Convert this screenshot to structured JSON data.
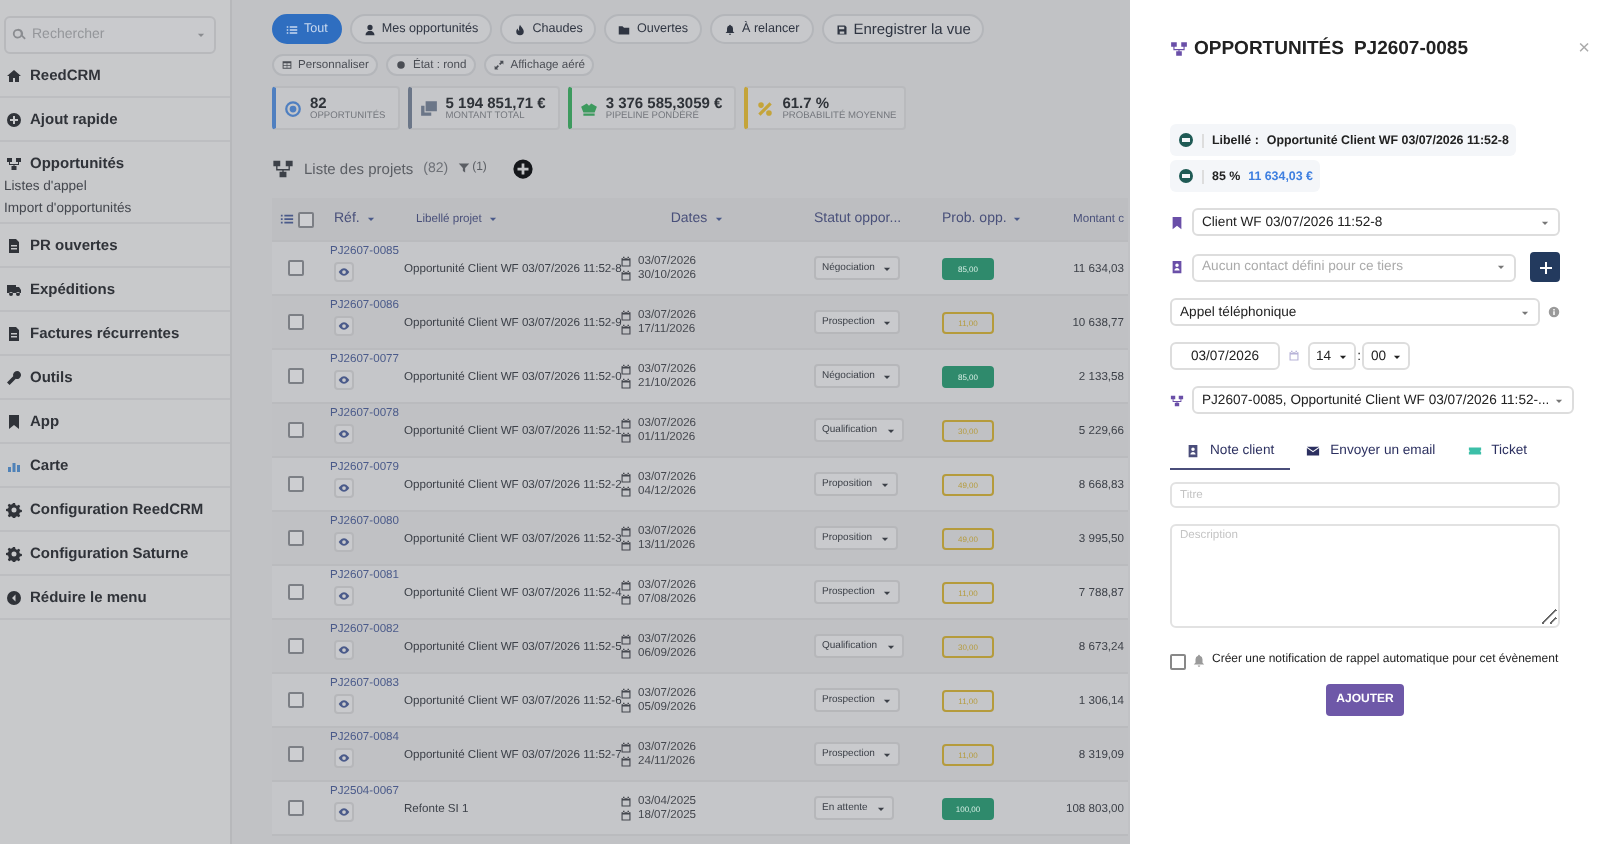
{
  "sidebar": {
    "search": {
      "placeholder": "Rechercher"
    },
    "items": [
      {
        "label": "ReedCRM"
      },
      {
        "label": "Ajout rapide"
      },
      {
        "label": "Opportunités",
        "children": [
          {
            "label": "Listes d'appel"
          },
          {
            "label": "Import d'opportunités"
          }
        ]
      },
      {
        "label": "PR ouvertes"
      },
      {
        "label": "Expéditions"
      },
      {
        "label": "Factures récurrentes"
      },
      {
        "label": "Outils"
      },
      {
        "label": "App"
      },
      {
        "label": "Carte"
      },
      {
        "label": "Configuration ReedCRM"
      },
      {
        "label": "Configuration Saturne"
      },
      {
        "label": "Réduire le menu"
      }
    ]
  },
  "filters": [
    {
      "label": "Tout",
      "selected": true
    },
    {
      "label": "Mes opportunités",
      "selected": false
    },
    {
      "label": "Chaudes",
      "selected": false
    },
    {
      "label": "Ouvertes",
      "selected": false
    },
    {
      "label": "À relancer",
      "selected": false
    }
  ],
  "save_view": "Enregistrer la vue",
  "options": [
    "Personnaliser",
    "État : rond",
    "Affichage aéré"
  ],
  "stats": [
    {
      "value": "82",
      "label": "OPPORTUNITÉS",
      "color": "#4f7fc0"
    },
    {
      "value": "5 194 851,71 €",
      "label": "MONTANT TOTAL",
      "color": "#6b7688"
    },
    {
      "value": "3 376 585,3059 €",
      "label": "PIPELINE PONDÉRÉ",
      "color": "#3d9a5e"
    },
    {
      "value": "61.7 %",
      "label": "PROBABILITÉ MOYENNE",
      "color": "#c4a43a"
    }
  ],
  "list": {
    "title": "Liste des projets",
    "count": "(82)",
    "filter_count": "(1)"
  },
  "table": {
    "select_all_checked": false,
    "columns": [
      {
        "label": "Réf.",
        "sortable": true
      },
      {
        "label": "Libellé projet",
        "sortable": true
      },
      {
        "label": "Dates",
        "sortable": true
      },
      {
        "label": "Statut oppor...",
        "sortable": false
      },
      {
        "label": "Prob. opp.",
        "sortable": true
      },
      {
        "label": "Montant c",
        "sortable": false
      }
    ],
    "rows": [
      {
        "ref": "PJ2607-0085",
        "label": "Opportunité Client WF 03/07/2026 11:52-8",
        "start": "03/07/2026",
        "end": "30/10/2026",
        "status": "Négociation",
        "prob": "85,00",
        "color": "#2f8a6c",
        "amount": "11 634,03",
        "checked": false
      },
      {
        "ref": "PJ2607-0086",
        "label": "Opportunité Client WF 03/07/2026 11:52-9",
        "start": "03/07/2026",
        "end": "17/11/2026",
        "status": "Prospection",
        "prob": "11,00",
        "color": "#b59b3c",
        "amount": "10 638,77",
        "checked": false
      },
      {
        "ref": "PJ2607-0077",
        "label": "Opportunité Client WF 03/07/2026 11:52-0",
        "start": "03/07/2026",
        "end": "21/10/2026",
        "status": "Négociation",
        "prob": "85,00",
        "color": "#2f8a6c",
        "amount": "2 133,58",
        "checked": false
      },
      {
        "ref": "PJ2607-0078",
        "label": "Opportunité Client WF 03/07/2026 11:52-1",
        "start": "03/07/2026",
        "end": "01/11/2026",
        "status": "Qualification",
        "prob": "30,00",
        "color": "#b59b3c",
        "amount": "5 229,66",
        "checked": false
      },
      {
        "ref": "PJ2607-0079",
        "label": "Opportunité Client WF 03/07/2026 11:52-2",
        "start": "03/07/2026",
        "end": "04/12/2026",
        "status": "Proposition",
        "prob": "49,00",
        "color": "#b59b3c",
        "amount": "8 668,83",
        "checked": false
      },
      {
        "ref": "PJ2607-0080",
        "label": "Opportunité Client WF 03/07/2026 11:52-3",
        "start": "03/07/2026",
        "end": "13/11/2026",
        "status": "Proposition",
        "prob": "49,00",
        "color": "#b59b3c",
        "amount": "3 995,50",
        "checked": false
      },
      {
        "ref": "PJ2607-0081",
        "label": "Opportunité Client WF 03/07/2026 11:52-4",
        "start": "03/07/2026",
        "end": "07/08/2026",
        "status": "Prospection",
        "prob": "11,00",
        "color": "#b59b3c",
        "amount": "7 788,87",
        "checked": false
      },
      {
        "ref": "PJ2607-0082",
        "label": "Opportunité Client WF 03/07/2026 11:52-5",
        "start": "03/07/2026",
        "end": "06/09/2026",
        "status": "Qualification",
        "prob": "30,00",
        "color": "#b59b3c",
        "amount": "8 673,24",
        "checked": false
      },
      {
        "ref": "PJ2607-0083",
        "label": "Opportunité Client WF 03/07/2026 11:52-6",
        "start": "03/07/2026",
        "end": "05/09/2026",
        "status": "Prospection",
        "prob": "11,00",
        "color": "#b59b3c",
        "amount": "1 306,14",
        "checked": false
      },
      {
        "ref": "PJ2607-0084",
        "label": "Opportunité Client WF 03/07/2026 11:52-7",
        "start": "03/07/2026",
        "end": "24/11/2026",
        "status": "Prospection",
        "prob": "11,00",
        "color": "#b59b3c",
        "amount": "8 319,09",
        "checked": false
      },
      {
        "ref": "PJ2504-0067",
        "label": "Refonte SI 1",
        "start": "03/04/2025",
        "end": "18/07/2025",
        "status": "En attente",
        "prob": "100,00",
        "color": "#2f8a6c",
        "amount": "108 803,00",
        "checked": false
      }
    ]
  },
  "panel": {
    "title": "OPPORTUNITÉS",
    "ref": "PJ2607-0085",
    "close": "×",
    "info": {
      "label": "Libellé :",
      "value": "Opportunité Client WF 03/07/2026 11:52-8",
      "prob": "85 %",
      "amount": "11 634,03 €"
    },
    "client": "Client WF 03/07/2026 11:52-8",
    "contact": {
      "placeholder": "Aucun contact défini pour ce tiers"
    },
    "type": "Appel téléphonique",
    "date": "03/07/2026",
    "hour": "14",
    "time_separator": ":",
    "minute": "00",
    "project": "PJ2607-0085, Opportunité Client WF 03/07/2026 11:52-...",
    "tabs": [
      {
        "label": "Note client",
        "selected": true
      },
      {
        "label": "Envoyer un email",
        "selected": false
      },
      {
        "label": "Ticket",
        "selected": false
      }
    ],
    "title_field": {
      "placeholder": "Titre"
    },
    "description": {
      "placeholder": "Description"
    },
    "reminder": {
      "label": "Créer une notification de rappel automatique pour cet évènement",
      "checked": false
    },
    "submit": "AJOUTER"
  }
}
